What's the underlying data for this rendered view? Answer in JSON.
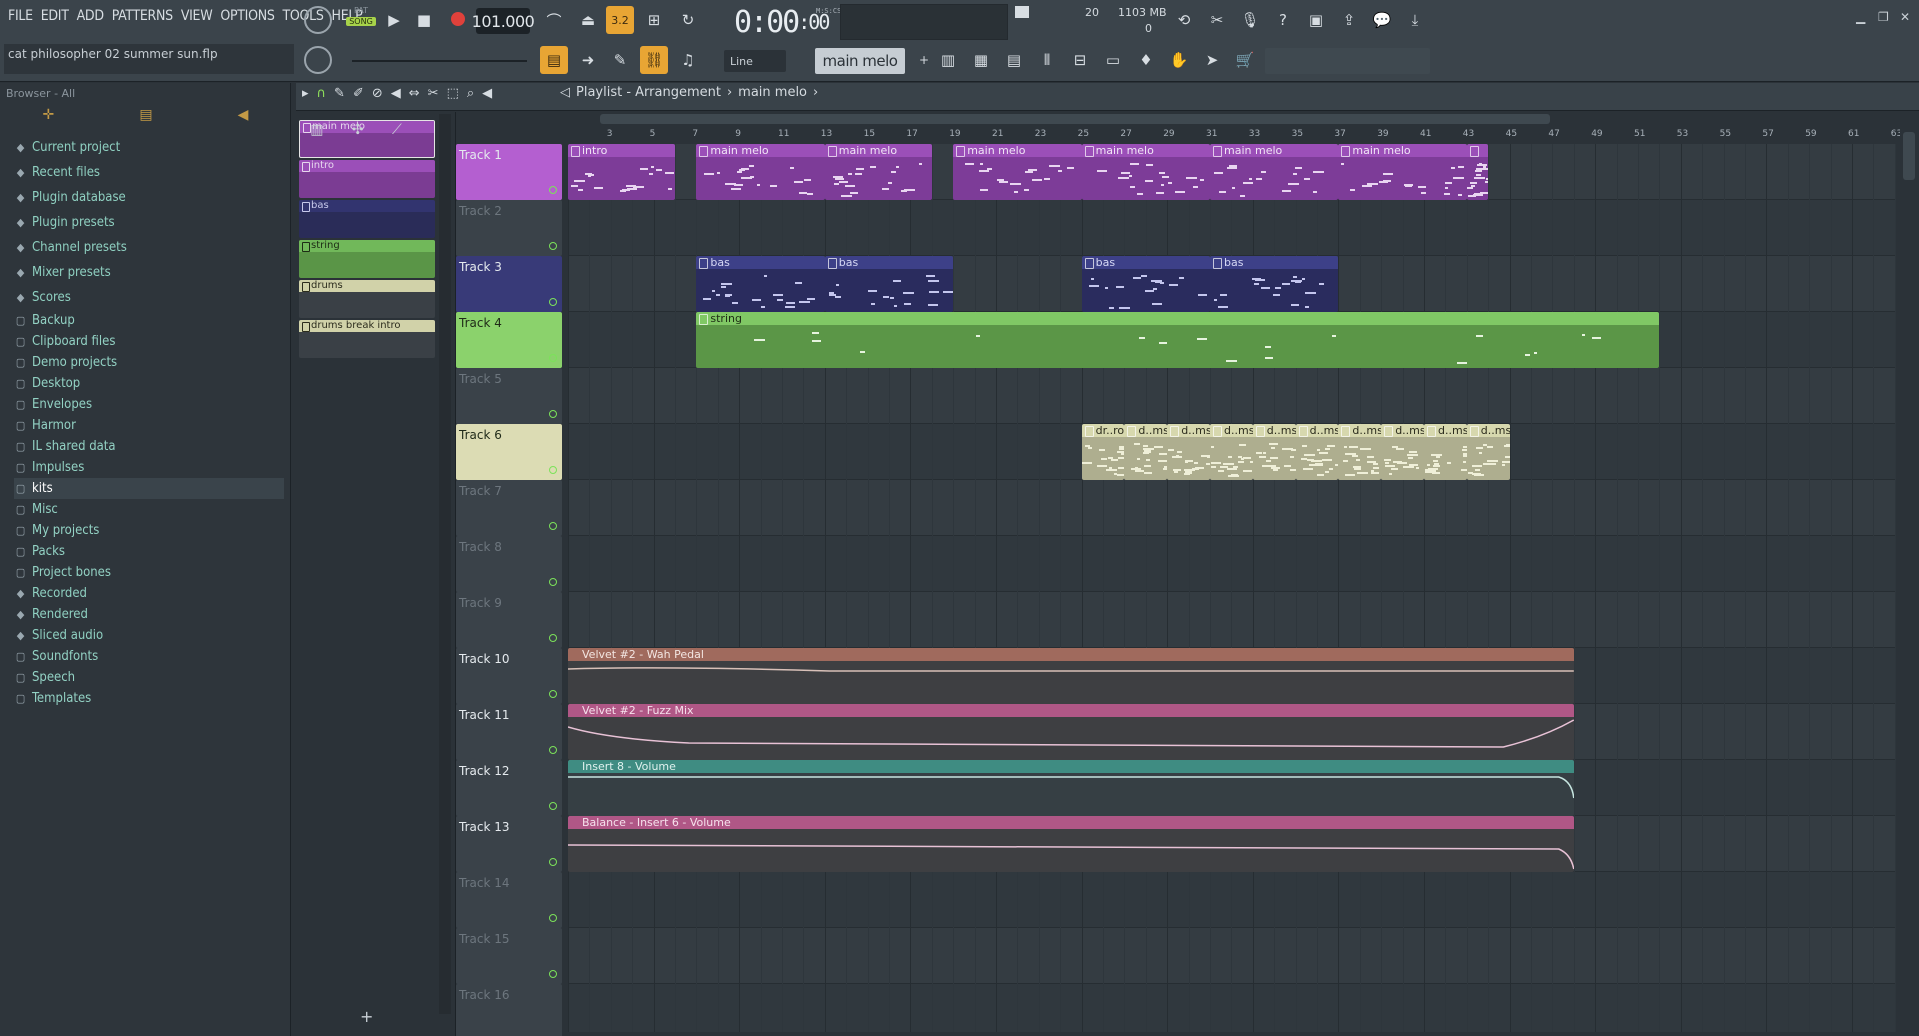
{
  "menu": [
    "FILE",
    "EDIT",
    "ADD",
    "PATTERNS",
    "VIEW",
    "OPTIONS",
    "TOOLS",
    "HELP"
  ],
  "transport": {
    "pat_label": "PAT",
    "song_label": "SONG",
    "tempo": "101.000",
    "time": "0:00",
    "time_small": ":00",
    "time_unit": "M:S:CS",
    "cpu": "20",
    "memory": "1103 MB",
    "voices": "0"
  },
  "project": {
    "title": "cat philosopher 02 summer sun.flp"
  },
  "toolbar2": {
    "snap": "Line",
    "pattern": "main melo"
  },
  "browser": {
    "header": "Browser - All",
    "items": [
      {
        "label": "Current project",
        "type": "special"
      },
      {
        "label": "Recent files",
        "type": "special"
      },
      {
        "label": "Plugin database",
        "type": "special"
      },
      {
        "label": "Plugin presets",
        "type": "special"
      },
      {
        "label": "Channel presets",
        "type": "special"
      },
      {
        "label": "Mixer presets",
        "type": "special"
      },
      {
        "label": "Scores",
        "type": "special"
      },
      {
        "label": "Backup",
        "type": "folder"
      },
      {
        "label": "Clipboard files",
        "type": "folder"
      },
      {
        "label": "Demo projects",
        "type": "folder"
      },
      {
        "label": "Desktop",
        "type": "folder"
      },
      {
        "label": "Envelopes",
        "type": "folder"
      },
      {
        "label": "Harmor",
        "type": "folder"
      },
      {
        "label": "IL shared data",
        "type": "folder"
      },
      {
        "label": "Impulses",
        "type": "folder"
      },
      {
        "label": "kits",
        "type": "folder",
        "selected": true
      },
      {
        "label": "Misc",
        "type": "folder"
      },
      {
        "label": "My projects",
        "type": "folder"
      },
      {
        "label": "Packs",
        "type": "folder"
      },
      {
        "label": "Project bones",
        "type": "folder"
      },
      {
        "label": "Recorded",
        "type": "special"
      },
      {
        "label": "Rendered",
        "type": "special"
      },
      {
        "label": "Sliced audio",
        "type": "special"
      },
      {
        "label": "Soundfonts",
        "type": "folder"
      },
      {
        "label": "Speech",
        "type": "folder"
      },
      {
        "label": "Templates",
        "type": "folder"
      }
    ]
  },
  "playlist": {
    "title": "Playlist - Arrangement",
    "pattern": "main melo",
    "bars": [
      "3",
      "5",
      "7",
      "9",
      "11",
      "13",
      "15",
      "17",
      "19",
      "21",
      "23",
      "25",
      "27",
      "29",
      "31",
      "33",
      "35",
      "37",
      "39",
      "41",
      "43",
      "45",
      "47",
      "49",
      "51",
      "53",
      "55",
      "57",
      "59",
      "61",
      "63"
    ],
    "tracks": [
      "Track 1",
      "Track 2",
      "Track 3",
      "Track 4",
      "Track 5",
      "Track 6",
      "Track 7",
      "Track 8",
      "Track 9",
      "Track 10",
      "Track 11",
      "Track 12",
      "Track 13",
      "Track 14",
      "Track 15",
      "Track 16"
    ],
    "patterns": [
      "main melo",
      "intro",
      "bas",
      "string",
      "drums",
      "drums break intro"
    ],
    "clip_labels": {
      "intro": "intro",
      "main": "main melo",
      "bas": "bas",
      "string": "string",
      "drum_a": "dr..ro",
      "drum_b": "d..ms",
      "wah": "Velvet #2 - Wah Pedal",
      "fuzz": "Velvet #2 - Fuzz Mix",
      "vol8": "Insert 8 - Volume",
      "bal6": "Balance - Insert 6 - Volume"
    }
  },
  "colors": {
    "purple": "#9b4fb8",
    "navy": "#32346f",
    "green": "#71b85a",
    "beige": "#d1d2a9",
    "brown": "#8f5a4e",
    "pink": "#a24f77",
    "teal": "#3a8178",
    "accent": "#e8a534"
  }
}
